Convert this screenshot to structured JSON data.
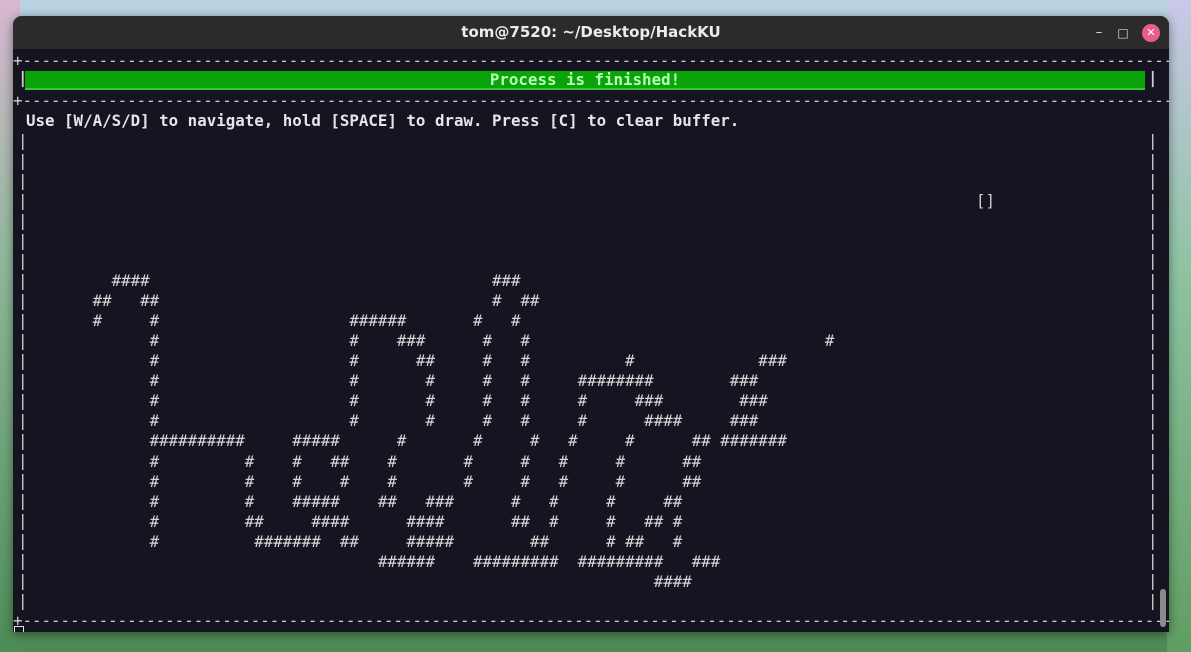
{
  "window": {
    "title": "tom@7520: ~/Desktop/HackKU",
    "buttons": {
      "minimize": "–",
      "maximize": "□",
      "close": "✕"
    }
  },
  "terminal": {
    "border_top": "+--------------------------------------------------------------------------------------------------------------------------------------------------+",
    "border_mid": "+--------------------------------------------------------------------------------------------------------------------------------------------------+",
    "border_bottom": "+--------------------------------------------------------------------------------------------------------------------------------------------------+",
    "status_banner": "Process is finished!",
    "instructions": "Use [W/A/S/D] to navigate, hold [SPACE] to draw. Press [C] to clear buffer.",
    "cursor_marker": "[]",
    "ascii_art": [
      "",
      "",
      "         ####                                    ###",
      "       ##   ##                                   #  ##",
      "       #     #                    ######       #   #",
      "             #                    #    ###      #   #                               #",
      "             #                    #      ##     #   #          #             ###",
      "             #                    #       #     #   #     ########        ###",
      "             #                    #       #     #   #     #     ###        ###",
      "             #                    #       #     #   #     #      ####     ###",
      "             ##########     #####      #       #     #   #     #      ## #######",
      "             #         #    #   ##    #       #     #   #     #      ##",
      "             #         #    #    #    #       #     #   #     #      ##",
      "             #         #    #####    ##   ###      #   #     #     ##",
      "             #         ##     ####      ####       ##  #     #   ## #",
      "             #          #######  ##     #####        ##      # ##   #",
      "                                     ######    #########  #########   ###",
      "                                                                  ####"
    ]
  }
}
